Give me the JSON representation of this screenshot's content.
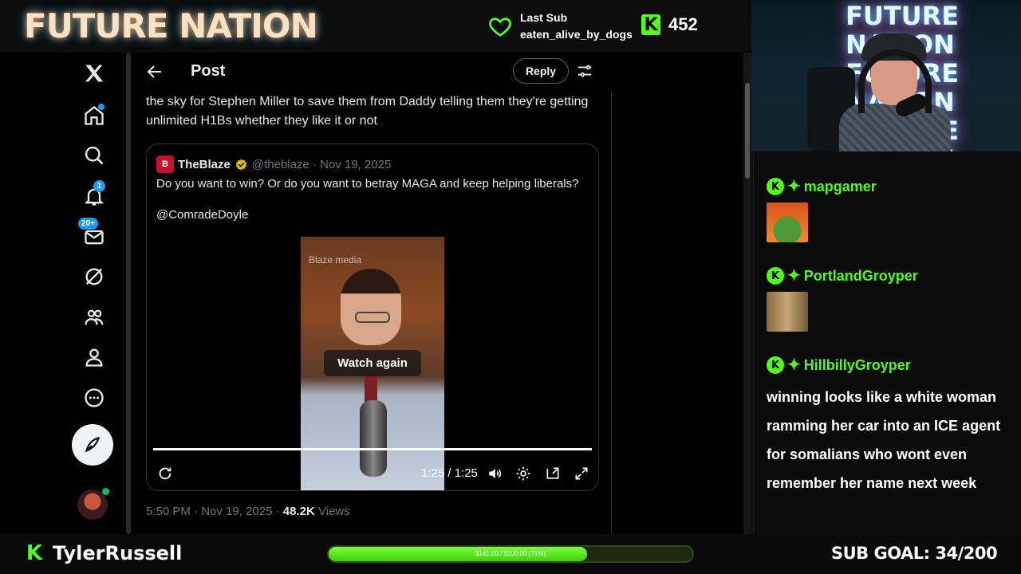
{
  "overlay": {
    "brand": "FUTURE NATION",
    "last_sub_label": "Last Sub",
    "last_sub_user": "eaten_alive_by_dogs",
    "follower_count": "452",
    "streamer_name": "TylerRussell",
    "sub_goal": "SUB GOAL: 34/200",
    "goal_bar_text": "$141.00 / $200.00 (71%)",
    "goal_progress": 0.71,
    "webcam_sign": "FUTURE NATION",
    "accent_color": "#53fc18"
  },
  "twitter": {
    "sidebar_icons": [
      "x-logo-icon",
      "home-icon",
      "search-icon",
      "bell-icon",
      "mail-icon",
      "grok-icon",
      "communities-icon",
      "profile-icon",
      "more-icon",
      "compose-icon",
      "avatar"
    ],
    "notifications_badge": "1",
    "messages_badge": "20+",
    "header": {
      "title": "Post",
      "reply_label": "Reply"
    },
    "tweet": {
      "text": "the sky for Stephen Miller to save them from Daddy telling them they're getting unlimited H1Bs whether they like it or not",
      "time": "5:50 PM · Nov 19, 2025 · ",
      "views_count": "48.2K",
      "views_label": " Views"
    },
    "quote": {
      "logo_text": "B",
      "name": "TheBlaze",
      "handle": "@theblaze · Nov 19, 2025",
      "text": "Do you want to win? Or do you want to betray MAGA and keep helping liberals?",
      "mention": "@ComradeDoyle",
      "video": {
        "watermark": "Blaze media",
        "overlay_label": "Watch again",
        "time": "1:25 / 1:25",
        "progress": 1.0
      }
    }
  },
  "chat": {
    "messages": [
      {
        "user": "mapgamer",
        "content": "emote"
      },
      {
        "user": "PortlandGroyper",
        "content": "emote"
      },
      {
        "user": "HillbillyGroyper",
        "content": "winning looks like a white woman ramming her car into an ICE agent for somalians who wont even remember her name next week"
      }
    ]
  }
}
